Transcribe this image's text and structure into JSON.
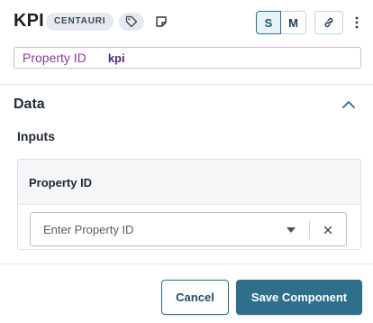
{
  "header": {
    "title": "KPI",
    "badge": "CENTAURI",
    "tag_icon": "tag-icon",
    "note_icon": "note-icon",
    "size_options": [
      "S",
      "M"
    ],
    "selected_size": "S",
    "link_icon": "link-icon",
    "more_icon": "more-vertical-icon"
  },
  "property": {
    "label": "Property ID",
    "value": "kpi"
  },
  "data_section": {
    "title": "Data",
    "collapse_icon": "chevron-up-icon",
    "inputs_label": "Inputs",
    "card": {
      "title": "Property ID",
      "select_placeholder": "Enter Property ID",
      "dropdown_icon": "caret-down-icon",
      "clear_icon": "close-icon"
    }
  },
  "footer": {
    "cancel_label": "Cancel",
    "save_label": "Save Component"
  },
  "colors": {
    "accent": "#2f6f8c",
    "property_label": "#8a3b9a",
    "property_value": "#4a2b7a",
    "badge_bg": "#e6eaf0"
  }
}
